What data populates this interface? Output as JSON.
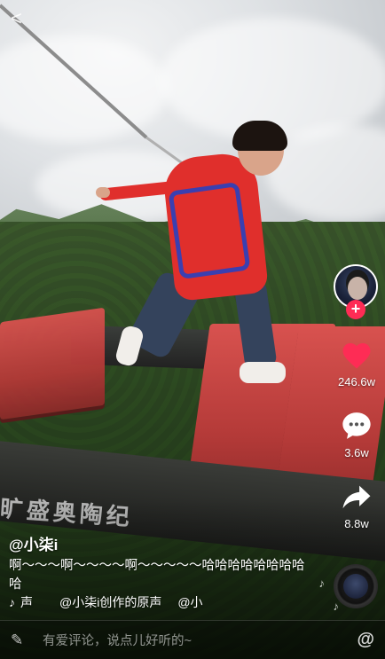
{
  "nav": {
    "back_glyph": "<"
  },
  "scene": {
    "sign_text": "旷盛奥陶纪"
  },
  "rail": {
    "follow_glyph": "+",
    "like_count": "246.6w",
    "comment_count": "3.6w",
    "share_count": "8.8w",
    "icons": [
      "avatar",
      "follow-plus-icon",
      "heart-icon",
      "comment-icon",
      "share-icon",
      "music-disc-icon"
    ]
  },
  "post": {
    "author": "@小柒i",
    "caption": "啊～～～啊～～～～啊～～～～～哈哈哈哈哈哈哈哈哈",
    "music_symbol": "♪",
    "music_glyph": "声",
    "music_title": "@小柒i创作的原声",
    "music_author": "@小"
  },
  "comment_bar": {
    "placeholder": "有爱评论，说点儿好听的~",
    "at_symbol": "@"
  },
  "colors": {
    "like": "#fe2c55",
    "follow": "#fe2c55",
    "text": "#ffffff"
  }
}
